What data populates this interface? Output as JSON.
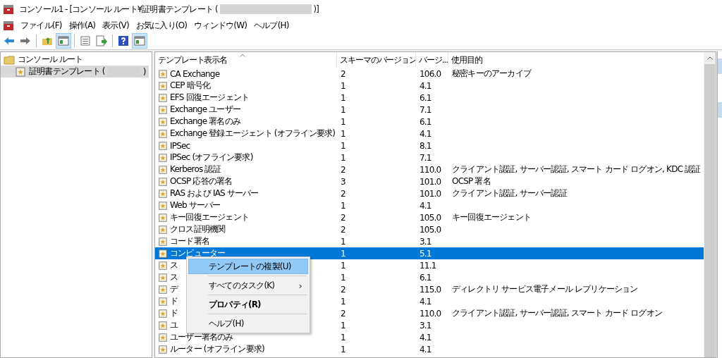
{
  "window": {
    "title_start": "コンソール1 - [コンソール ルート¥証明書テンプレート (",
    "title_end": ")]"
  },
  "menu": [
    "ファイル(F)",
    "操作(A)",
    "表示(V)",
    "お気に入り(O)",
    "ウィンドウ(W)",
    "ヘルプ(H)"
  ],
  "toolbar": [
    {
      "pressed": false
    },
    {
      "pressed": false
    },
    {
      "pressed": false
    },
    {
      "pressed": true
    },
    {
      "pressed": false
    },
    {
      "pressed": false
    },
    {
      "pressed": false
    },
    {
      "pressed": true
    }
  ],
  "tree": [
    {
      "label": "コンソール ルート",
      "selected": false,
      "children": [
        {
          "label": "証明書テンプレート (",
          "label_end": ")",
          "selected": true
        }
      ]
    }
  ],
  "table": {
    "columns": [
      "テンプレート表示名",
      "スキーマのバージョン",
      "バージ...",
      "使用目的"
    ],
    "rows": [
      {
        "name": "CA Exchange",
        "schema": "2",
        "version": "106.0",
        "purpose": "秘密キーのアーカイブ",
        "selected": false
      },
      {
        "name": "CEP 暗号化",
        "schema": "1",
        "version": "4.1",
        "selected": false
      },
      {
        "name": "EFS 回復エージェント",
        "schema": "1",
        "version": "6.1",
        "selected": false
      },
      {
        "name": "Exchange ユーザー",
        "schema": "1",
        "version": "7.1",
        "selected": false
      },
      {
        "name": "Exchange 署名のみ",
        "schema": "1",
        "version": "6.1",
        "selected": false
      },
      {
        "name": "Exchange 登録エージェント (オフライン要求)",
        "schema": "1",
        "version": "4.1",
        "selected": false
      },
      {
        "name": "IPSec",
        "schema": "1",
        "version": "8.1",
        "selected": false
      },
      {
        "name": "IPSec (オフライン要求)",
        "schema": "1",
        "version": "7.1",
        "selected": false
      },
      {
        "name": "Kerberos 認証",
        "schema": "2",
        "version": "110.0",
        "purpose": "クライアント認証, サーバー認証, スマート カード ログオン, KDC 認証",
        "selected": false
      },
      {
        "name": "OCSP 応答の署名",
        "schema": "3",
        "version": "101.0",
        "purpose": "OCSP 署名",
        "selected": false
      },
      {
        "name": "RAS および IAS サーバー",
        "schema": "2",
        "version": "101.0",
        "purpose": "クライアント認証, サーバー認証",
        "selected": false
      },
      {
        "name": "Web サーバー",
        "schema": "1",
        "version": "4.1",
        "selected": false
      },
      {
        "name": "キー回復エージェント",
        "schema": "2",
        "version": "105.0",
        "purpose": "キー回復エージェント",
        "selected": false
      },
      {
        "name": "クロス証明機関",
        "schema": "2",
        "version": "105.0",
        "selected": false
      },
      {
        "name": "コード署名",
        "schema": "1",
        "version": "3.1",
        "selected": false
      },
      {
        "name": "コンピューター",
        "schema": "1",
        "version": "5.1",
        "selected": true
      },
      {
        "name": "ス",
        "schema": "1",
        "version": "11.1",
        "selected": false
      },
      {
        "name": "ス",
        "schema": "1",
        "version": "6.1",
        "selected": false
      },
      {
        "name": "デ",
        "schema": "2",
        "version": "115.0",
        "purpose": "ディレクトリ サービス電子メール レプリケーション",
        "selected": false
      },
      {
        "name": "ド",
        "schema": "1",
        "version": "4.1",
        "selected": false
      },
      {
        "name": "ド",
        "schema": "2",
        "version": "110.0",
        "purpose": "クライアント認証, サーバー認証, スマート カード ログオン",
        "selected": false
      },
      {
        "name": "ユ",
        "schema": "1",
        "version": "3.1",
        "selected": false
      },
      {
        "name": "ユーザー署名のみ",
        "schema": "1",
        "version": "4.1",
        "selected": false
      },
      {
        "name": "ルーター (オフライン要求)",
        "schema": "1",
        "version": "4.1",
        "selected": false
      }
    ]
  },
  "context_menu": [
    {
      "label": "テンプレートの複製(U)",
      "selected": true,
      "bold": false
    },
    {
      "label": "すべてのタスク(K)",
      "submenu": "›",
      "selected": false,
      "bold": false
    },
    {
      "label": "プロパティ(R)",
      "selected": false,
      "bold": true
    },
    {
      "label": "ヘルプ(H)",
      "selected": false,
      "bold": false
    }
  ]
}
